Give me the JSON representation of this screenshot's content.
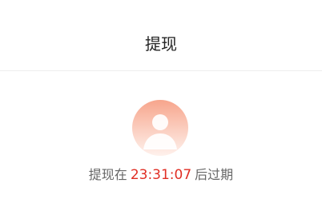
{
  "header": {
    "title": "提现"
  },
  "avatar": {
    "icon": "user-avatar-icon"
  },
  "countdown": {
    "prefix": "提现在",
    "time": "23:31:07",
    "suffix": "后过期"
  },
  "colors": {
    "accent": "#e02e24",
    "text_secondary": "#666666",
    "title": "#222222",
    "avatar_top": "#f7a58c",
    "avatar_bottom": "#fef1ec"
  }
}
